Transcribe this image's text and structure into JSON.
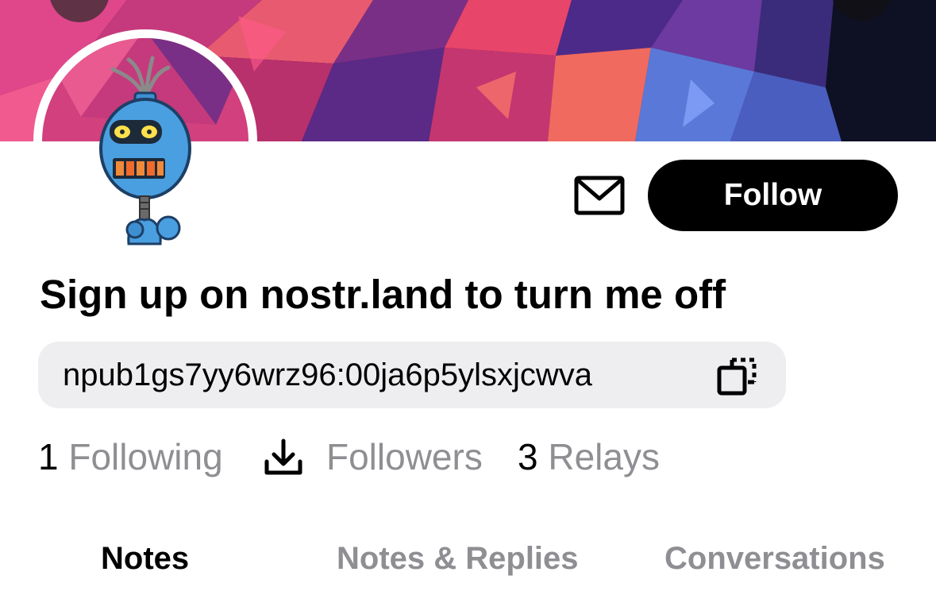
{
  "profile": {
    "display_name": "Sign up on nostr.land to turn me off",
    "npub": "npub1gs7yy6wrz96:00ja6p5ylsxjcwva",
    "follow_label": "Follow"
  },
  "icons": {
    "message": "envelope-icon",
    "copy": "copy-icon",
    "download": "download-icon"
  },
  "stats": {
    "following_count": "1",
    "following_label": "Following",
    "followers_label": "Followers",
    "relays_count": "3",
    "relays_label": "Relays"
  },
  "tabs": [
    {
      "label": "Notes",
      "active": true
    },
    {
      "label": "Notes & Replies",
      "active": false
    },
    {
      "label": "Conversations",
      "active": false
    }
  ],
  "colors": {
    "button_bg": "#000000",
    "muted_text": "#8e8e93",
    "pill_bg": "#eeeef0"
  }
}
